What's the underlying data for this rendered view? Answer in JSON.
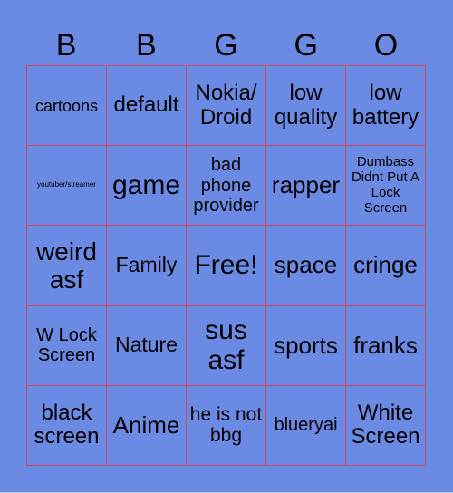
{
  "header": {
    "letters": [
      "B",
      "B",
      "G",
      "G",
      "O"
    ]
  },
  "colors": {
    "background": "#6a8ae4",
    "grid_line": "#cf4a5c",
    "text": "#000000"
  },
  "cells": [
    {
      "text": "cartoons",
      "size": 18
    },
    {
      "text": "default",
      "size": 24
    },
    {
      "text": "Nokia/ Droid",
      "size": 24
    },
    {
      "text": "low quality",
      "size": 24
    },
    {
      "text": "low battery",
      "size": 24
    },
    {
      "text": "youtuber/streamer",
      "size": 8
    },
    {
      "text": "game",
      "size": 30
    },
    {
      "text": "bad phone provider",
      "size": 20
    },
    {
      "text": "rapper",
      "size": 26
    },
    {
      "text": "Dumbass Didnt Put A Lock Screen",
      "size": 15
    },
    {
      "text": "weird asf",
      "size": 28
    },
    {
      "text": "Family",
      "size": 23
    },
    {
      "text": "Free!",
      "size": 30
    },
    {
      "text": "space",
      "size": 26
    },
    {
      "text": "cringe",
      "size": 26
    },
    {
      "text": "W Lock Screen",
      "size": 20
    },
    {
      "text": "Nature",
      "size": 23
    },
    {
      "text": "sus asf",
      "size": 30
    },
    {
      "text": "sports",
      "size": 26
    },
    {
      "text": "franks",
      "size": 26
    },
    {
      "text": "black screen",
      "size": 24
    },
    {
      "text": "Anime",
      "size": 26
    },
    {
      "text": "he is not bbg",
      "size": 21
    },
    {
      "text": "blueryai",
      "size": 20
    },
    {
      "text": "White Screen",
      "size": 24
    }
  ]
}
